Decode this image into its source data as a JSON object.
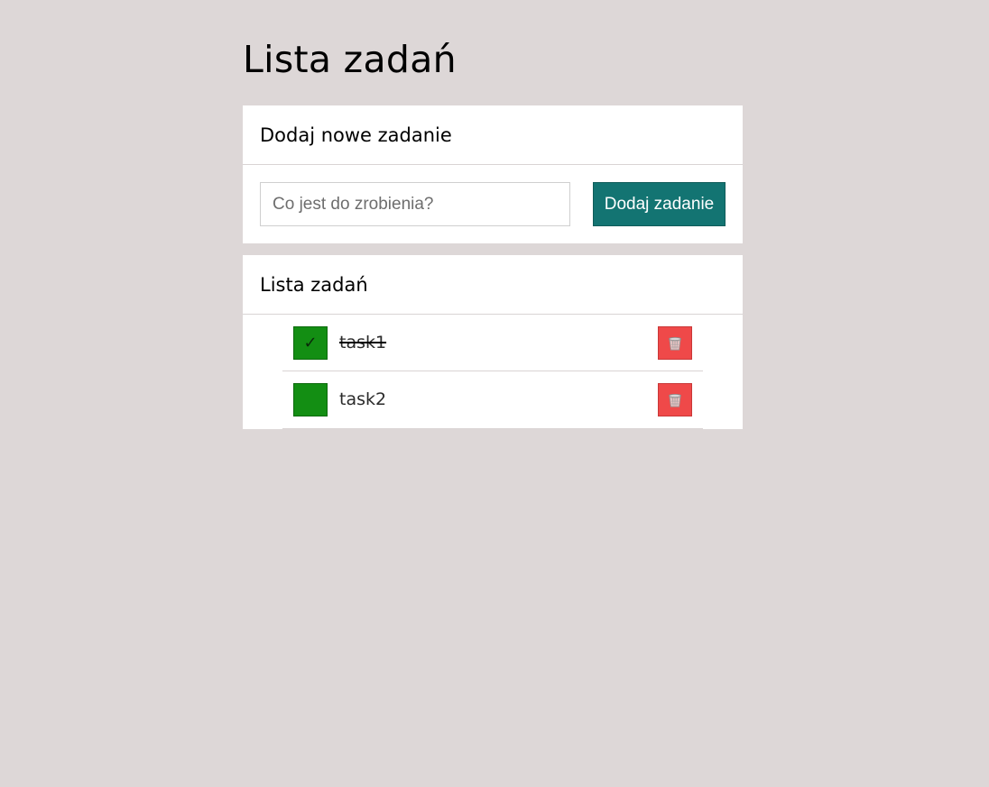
{
  "page": {
    "title": "Lista zadań"
  },
  "add_card": {
    "title": "Dodaj nowe zadanie",
    "input_placeholder": "Co jest do zrobienia?",
    "input_value": "",
    "button_label": "Dodaj zadanie"
  },
  "list_card": {
    "title": "Lista zadań",
    "tasks": [
      {
        "text": "task1",
        "done": true,
        "check_glyph": "✓"
      },
      {
        "text": "task2",
        "done": false,
        "check_glyph": ""
      }
    ]
  },
  "icons": {
    "check": "check-icon",
    "delete": "trash-icon"
  },
  "colors": {
    "background": "#ddd7d7",
    "card": "#ffffff",
    "primary_button": "#137472",
    "check_green": "#138e13",
    "delete_red": "#ef4949"
  }
}
